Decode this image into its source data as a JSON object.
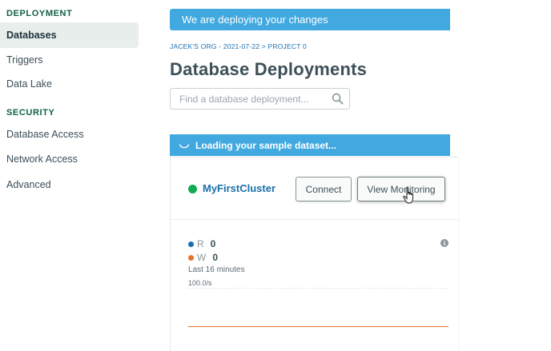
{
  "sidebar": {
    "sections": [
      {
        "title": "DEPLOYMENT",
        "items": [
          {
            "label": "Databases",
            "active": true
          },
          {
            "label": "Triggers"
          },
          {
            "label": "Data Lake"
          }
        ]
      },
      {
        "title": "SECURITY",
        "items": [
          {
            "label": "Database Access"
          },
          {
            "label": "Network Access"
          },
          {
            "label": "Advanced"
          }
        ]
      }
    ]
  },
  "main": {
    "deploy_banner": "We are deploying your changes",
    "breadcrumb": "JACEK'S ORG - 2021-07-22 > PROJECT 0",
    "page_title": "Database Deployments",
    "search": {
      "placeholder": "Find a database deployment...",
      "value": ""
    },
    "loading_banner": "Loading your sample dataset...",
    "cluster": {
      "name": "MyFirstCluster",
      "status_color": "#13aa52",
      "connect_label": "Connect",
      "monitor_label": "View Monitoring",
      "metrics": [
        {
          "label": "R",
          "value": "0",
          "color": "#1a6fb0"
        },
        {
          "label": "W",
          "value": "0",
          "color": "#e6712a"
        }
      ],
      "time_caption": "Last 16 minutes",
      "rate_label": "100.0/s"
    }
  },
  "colors": {
    "accent": "#41a9e0",
    "brand_green": "#116149",
    "link": "#1a6fa8"
  }
}
